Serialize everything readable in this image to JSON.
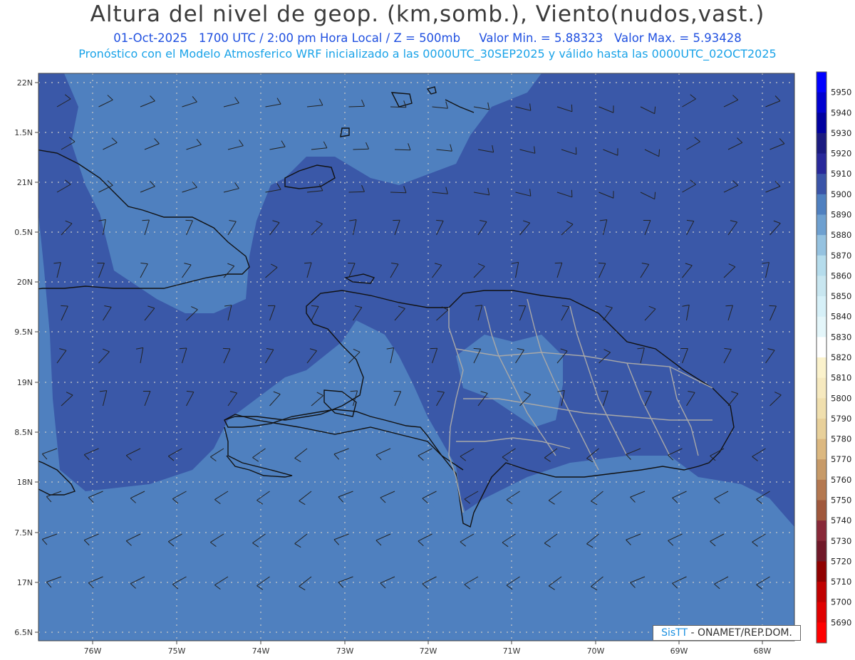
{
  "header": {
    "title": "Altura del nivel de geop. (km,somb.), Viento(nudos,vast.)",
    "date": "01-Oct-2025",
    "time": "1700 UTC / 2:00 pm Hora Local / Z = 500mb",
    "min_label": "Valor Min. = 5.88323",
    "max_label": "Valor Max. = 5.93428",
    "forecast": "Pronóstico con el Modelo Atmosferico WRF inicializado a las 0000UTC_30SEP2025 y válido hasta las  0000UTC_02OCT2025"
  },
  "axes": {
    "lat_labels": [
      "22N",
      "1.5N",
      "21N",
      "0.5N",
      "20N",
      "9.5N",
      "19N",
      "8.5N",
      "18N",
      "7.5N",
      "17N",
      "6.5N"
    ],
    "lon_labels": [
      "76W",
      "75W",
      "74W",
      "73W",
      "72W",
      "71W",
      "70W",
      "69W",
      "68W"
    ]
  },
  "colorbar": {
    "levels": [
      "5950",
      "5940",
      "5930",
      "5920",
      "5910",
      "5900",
      "5890",
      "5880",
      "5870",
      "5860",
      "5850",
      "5840",
      "5830",
      "5820",
      "5810",
      "5800",
      "5790",
      "5780",
      "5770",
      "5760",
      "5750",
      "5740",
      "5730",
      "5720",
      "5710",
      "5700",
      "5690"
    ],
    "colors": [
      "#0000ff",
      "#0000d0",
      "#0000a0",
      "#1a1a80",
      "#28289a",
      "#3a54a8",
      "#4f80c0",
      "#6ea0d0",
      "#95c2e0",
      "#b5dcec",
      "#c8e6f0",
      "#d6f0f8",
      "#e4f6fa",
      "#ffffff",
      "#fbf2cc",
      "#f6e9bf",
      "#f0dfae",
      "#e8d09a",
      "#dcb880",
      "#c79a68",
      "#b47850",
      "#a0583c",
      "#882838",
      "#701828",
      "#900000",
      "#c00000",
      "#e00000",
      "#ff0000"
    ]
  },
  "map": {
    "colors": {
      "ocean_dark": "#3a58a8",
      "ocean_mid": "#4f80bf",
      "coast": "#111111",
      "province": "#a8a8a8",
      "grid": "#c8c8c8"
    }
  },
  "credit": {
    "brand": "SisTT",
    "text": " - ONAMET/REP.DOM."
  }
}
